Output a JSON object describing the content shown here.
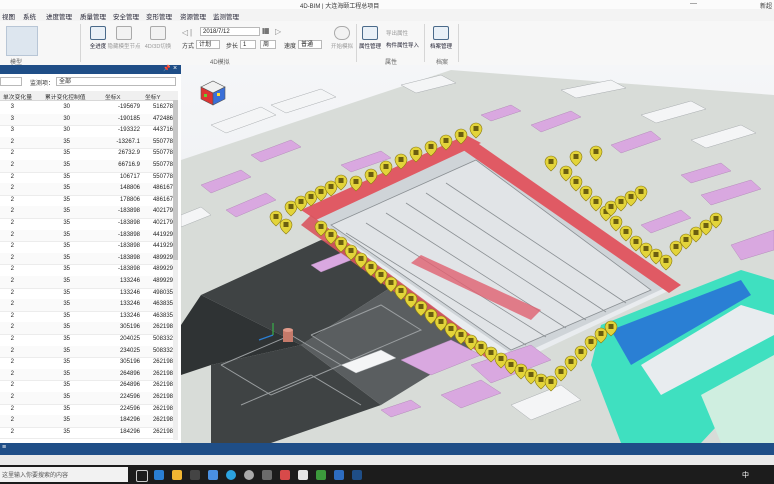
{
  "window": {
    "title": "4D-BIM  |  大连海颐工程总项目",
    "right_label": "新超"
  },
  "menu": [
    "视图",
    "系统",
    "进度管理",
    "质量管理",
    "安全管理",
    "变形管理",
    "资源管理",
    "监测管理"
  ],
  "ribbon": {
    "group_model_label": "模型",
    "buttons": [
      {
        "label": "全进度",
        "enabled": true
      },
      {
        "label": "隐藏模型节点",
        "enabled": false
      },
      {
        "label": "4D/3D切换",
        "enabled": false
      }
    ],
    "mode_label": "方式",
    "mode_value": "计划",
    "date_value": "2018/7/12",
    "step_label": "步长",
    "step_value": "1",
    "step_unit": "周",
    "speed_label": "速度",
    "speed_value": "普通",
    "start_sim_label": "开始模拟",
    "group_4d_label": "4D模拟",
    "attr_mgmt_label": "属性管理",
    "export_attr_label": "导出属性",
    "import_attr_label": "构件属性导入",
    "group_attr_label": "属性",
    "archive_mgmt_label": "档案管理",
    "group_archive_label": "档案"
  },
  "panel": {
    "filter_label": "监测项：",
    "filter_value": "全部",
    "columns": [
      "单次变化量",
      "累计变化控制值",
      "坐标X",
      "坐标Y"
    ],
    "rows": [
      [
        "3",
        "30",
        "-195679",
        "516278"
      ],
      [
        "3",
        "30",
        "-190185",
        "472486"
      ],
      [
        "3",
        "30",
        "-193322",
        "443716"
      ],
      [
        "2",
        "35",
        "-13267.1",
        "550778"
      ],
      [
        "2",
        "35",
        "26732.9",
        "550778"
      ],
      [
        "2",
        "35",
        "66716.9",
        "550778"
      ],
      [
        "2",
        "35",
        "106717",
        "550778"
      ],
      [
        "2",
        "35",
        "148806",
        "486167"
      ],
      [
        "2",
        "35",
        "178806",
        "486167"
      ],
      [
        "2",
        "35",
        "-183898",
        "402179"
      ],
      [
        "2",
        "35",
        "-183898",
        "402179"
      ],
      [
        "2",
        "35",
        "-183898",
        "441929"
      ],
      [
        "2",
        "35",
        "-183898",
        "441929"
      ],
      [
        "2",
        "35",
        "-183898",
        "489929"
      ],
      [
        "2",
        "35",
        "-183898",
        "489929"
      ],
      [
        "2",
        "35",
        "133246",
        "489929"
      ],
      [
        "2",
        "35",
        "133246",
        "498035"
      ],
      [
        "2",
        "35",
        "133246",
        "463835"
      ],
      [
        "2",
        "35",
        "133246",
        "463835"
      ],
      [
        "2",
        "35",
        "305196",
        "262198"
      ],
      [
        "2",
        "35",
        "204025",
        "508332"
      ],
      [
        "2",
        "35",
        "234025",
        "508332"
      ],
      [
        "2",
        "35",
        "305196",
        "262198"
      ],
      [
        "2",
        "35",
        "264896",
        "262198"
      ],
      [
        "2",
        "35",
        "264896",
        "262198"
      ],
      [
        "2",
        "35",
        "224596",
        "262198"
      ],
      [
        "2",
        "35",
        "224596",
        "262198"
      ],
      [
        "2",
        "35",
        "184296",
        "262198"
      ],
      [
        "2",
        "35",
        "184296",
        "262198"
      ]
    ]
  },
  "taskbar": {
    "search_placeholder": "这里输入你要搜索的内容",
    "ime": "中"
  },
  "colors": {
    "panel_header": "#1f4e87",
    "marker": "#e3d43a",
    "platform": "#e05a64",
    "selected_pink": "#d9a8e0",
    "cyan": "#3fe0c0"
  }
}
